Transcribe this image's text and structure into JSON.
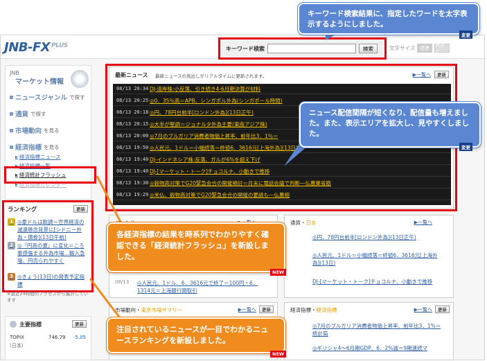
{
  "header": {
    "logo": "JNB-FX",
    "logo_plus": "PLUS",
    "search_label": "キーワード検索",
    "search_value": "",
    "search_button": "検索",
    "text_size_label": "文字サイズ",
    "text_size_standard": "標準",
    "text_size_large": "大きく"
  },
  "sidebar": {
    "brand_small": "JNB",
    "brand_title": "マーケット情報",
    "nav": [
      {
        "label": "ニュースジャンル",
        "suffix": "で探す"
      },
      {
        "label": "通貨",
        "suffix": "で探す"
      },
      {
        "label": "市場動向",
        "suffix": "を見る"
      },
      {
        "label": "経済指標",
        "suffix": "を見る"
      }
    ],
    "sub_items": [
      "経済指標ニュース",
      "経済指標一覧",
      "経済統計フラッシュ",
      "経済指標カレンダー"
    ],
    "ranking_title": "ランキング",
    "update_label": "更新",
    "ranking": [
      {
        "rank": "1",
        "text": "◎豪ドルは軟調＝世界経済の減速懸念背景に[シドニー外為・債券](13日午前)"
      },
      {
        "rank": "2",
        "text": "◎『円高の夏』に変化＝ころ着感強まる外為市場…輸入急増、円売られやすく"
      },
      {
        "rank": "3",
        "text": "◎きょう(13日)の発表予定指標"
      }
    ],
    "ranking_note": "※直近24時間のアクセスから集計しています",
    "main_index_title": "主要指標",
    "main_index_row": {
      "name": "TOPIX",
      "market": "(日本)",
      "value": "746.79",
      "change": "-5.05"
    }
  },
  "news": {
    "title": "最新ニュース",
    "subtitle": "最新ニュースの見出しがリアルタイムに更新されます。",
    "more": "一覧へ",
    "update": "更新",
    "rows": [
      {
        "datetime": "08/13 20:34",
        "headline": "DJ-清岸株:小反落、引き続き4-6月期決算が材料"
      },
      {
        "datetime": "08/13 20:25",
        "headline": "◎0．35％高＝APB、シンガポル外為(シンガポール時間)"
      },
      {
        "datetime": "08/13 20:18",
        "headline": "◎円、78円台前半[ロンドン外為](13日正午)"
      },
      {
        "datetime": "08/13 20:15",
        "headline": "◎大半が堅調＝ジョナルタ外為主要(東南アジア株)"
      },
      {
        "datetime": "08/13 20:00",
        "headline": "◎7月のブルガリア消費者物価上昇率、前年比3．1％＝"
      },
      {
        "datetime": "08/13 19:50",
        "headline": "◎人民元、1ドル＝小幅続落＝終値6．3616元[上海外為](13日)"
      },
      {
        "datetime": "08/13 19:40",
        "headline": "DJ-インドネシア株:反落、ガルが6%を超え下げ"
      },
      {
        "datetime": "08/13 19:40",
        "headline": "DJ-[マーケット・トーク]チョコルナ、小動きで推移"
      },
      {
        "datetime": "08/13 19:30",
        "headline": "◎穀物高対策でG20緊急会合の開催検討＝月末に電話会議で判断―仏農業省筋"
      },
      {
        "datetime": "08/13 19:29",
        "headline": "◎米仏、穀物高対策でG20緊急会合の開催の要請も―仏農相"
      }
    ]
  },
  "panels": {
    "genre": {
      "label": "ジャンル",
      "more": "一覧へ",
      "date": "08/13",
      "item": "◎人民元、1ドル．6．3616元で終了＝100円・6．1314元＝上海銀行間取引"
    },
    "currency": {
      "label": "通貨",
      "category": "日本",
      "more": "一覧へ",
      "items": [
        "◎円、78円台前半[ロンドン外為](13日正午)",
        "◎人民元、1ドル＝小幅続落＝終値6．3616元[上海外為](13日)",
        "DJ-[マーケット・トーク]チョコルナ、小動きで推移"
      ],
      "new_badge": "NEW"
    },
    "market": {
      "label": "市場動向",
      "category": "東京市場サマリー",
      "more": "一覧へ",
      "update": "更新"
    },
    "indicators": {
      "label": "経済指標",
      "category": "経済指標",
      "more": "一覧へ",
      "update": "更新",
      "items": [
        "◎7月のブルガリア消費者物価上昇率、前年比3．1%＝統計局",
        "◎ギリシャ4～6月期GDP、6．2%減＝9期連続マ"
      ],
      "new_badge": "NEW"
    }
  },
  "callouts": {
    "search": "キーワード検索結果に、指定したワードを太字表示するようにしました。",
    "news": "ニュース配信間隔が短くなり、配信量も増えました。また、表示エリアを拡大し、見やすくしました。",
    "flash": "各経済指標の結果を時系列でわかりやすく確認できる「経済統計フラッシュ」を新設しました。",
    "ranking": "注目されているニュースが一目でわかるニュースランキングを新設しました。",
    "change_badge": "変更",
    "new_badge": "NEW"
  },
  "colors": {
    "highlight_red": "#e50012",
    "callout_blue": "#5a86d2",
    "callout_orange": "#f08c1e",
    "news_bg": "#1a1a1a",
    "news_text": "#f6c500"
  }
}
